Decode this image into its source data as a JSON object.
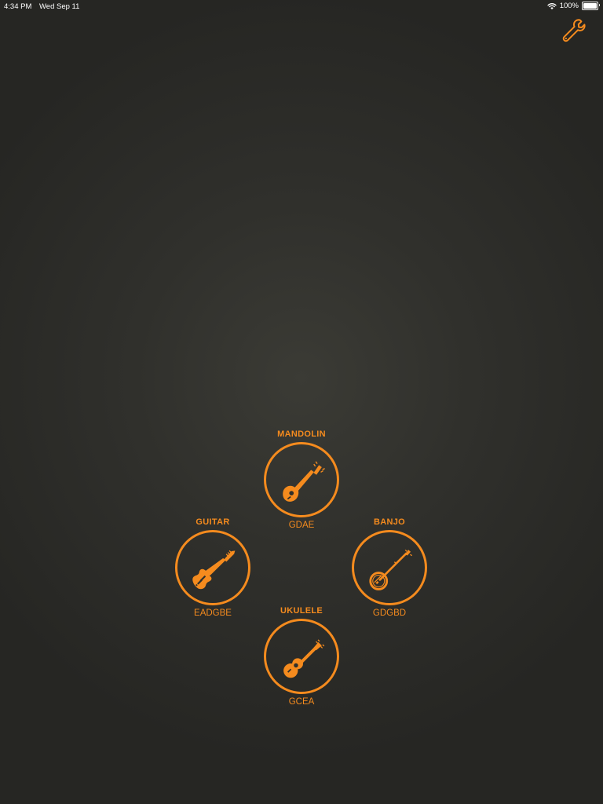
{
  "status_bar": {
    "time": "4:34 PM",
    "date": "Wed Sep 11",
    "battery": "100%",
    "wifi_icon": "wifi-icon",
    "battery_icon": "battery-full-icon"
  },
  "toolbar": {
    "settings_icon": "wrench-icon"
  },
  "colors": {
    "accent": "#f58b1e",
    "background": "#30302c",
    "status_text": "#ffffff"
  },
  "instruments": {
    "mandolin": {
      "name": "MANDOLIN",
      "tuning": "GDAE",
      "icon": "mandolin-icon"
    },
    "guitar": {
      "name": "GUITAR",
      "tuning": "EADGBE",
      "icon": "electric-guitar-icon"
    },
    "banjo": {
      "name": "BANJO",
      "tuning": "GDGBD",
      "icon": "banjo-icon"
    },
    "ukulele": {
      "name": "UKULELE",
      "tuning": "GCEA",
      "icon": "ukulele-icon"
    }
  }
}
